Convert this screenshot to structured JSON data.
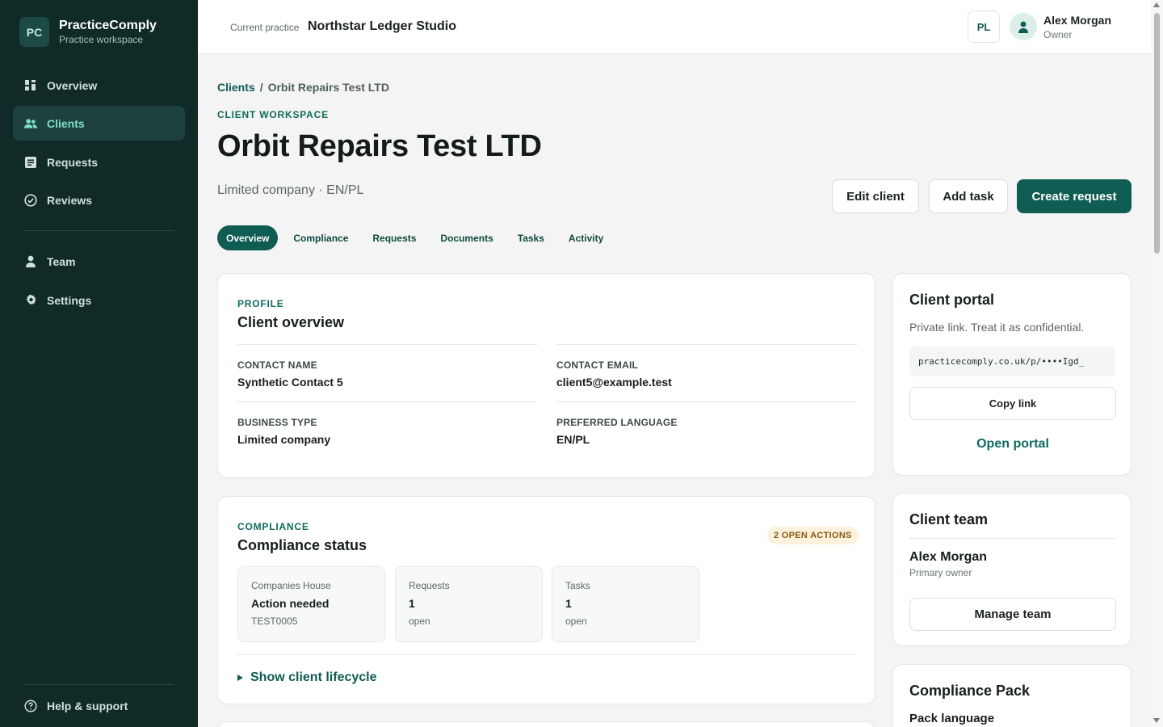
{
  "brand": {
    "logo_text": "PC",
    "name": "PracticeComply",
    "subtitle": "Practice workspace"
  },
  "sidebar": {
    "items": [
      {
        "label": "Overview",
        "icon": "grid-icon"
      },
      {
        "label": "Clients",
        "icon": "users-icon",
        "active": true
      },
      {
        "label": "Requests",
        "icon": "inbox-icon"
      },
      {
        "label": "Reviews",
        "icon": "check-circle-icon"
      },
      {
        "label": "Team",
        "icon": "user-icon"
      },
      {
        "label": "Settings",
        "icon": "gear-icon"
      }
    ],
    "help_label": "Help & support"
  },
  "topbar": {
    "current_practice_label": "Current practice",
    "current_practice_name": "Northstar Ledger Studio",
    "language_badge": "PL",
    "user_name": "Alex Morgan",
    "user_role": "Owner"
  },
  "breadcrumb": {
    "parent": "Clients",
    "separator": "/",
    "current": "Orbit Repairs Test LTD"
  },
  "header": {
    "eyebrow": "CLIENT WORKSPACE",
    "title": "Orbit Repairs Test LTD",
    "subtitle": "Limited company · EN/PL",
    "edit_label": "Edit client",
    "add_task_label": "Add task",
    "create_request_label": "Create request"
  },
  "tabs": [
    "Overview",
    "Compliance",
    "Requests",
    "Documents",
    "Tasks",
    "Activity"
  ],
  "profile": {
    "eyebrow": "PROFILE",
    "title": "Client overview",
    "contact_name_label": "CONTACT NAME",
    "contact_name": "Synthetic Contact 5",
    "contact_email_label": "CONTACT EMAIL",
    "contact_email": "client5@example.test",
    "business_type_label": "BUSINESS TYPE",
    "business_type": "Limited company",
    "language_label": "PREFERRED LANGUAGE",
    "language": "EN/PL"
  },
  "compliance": {
    "eyebrow": "COMPLIANCE",
    "title": "Compliance status",
    "badge": "2 OPEN ACTIONS",
    "stats": [
      {
        "label": "Companies House",
        "value": "Action needed",
        "sub": "TEST0005"
      },
      {
        "label": "Requests",
        "value": "1",
        "sub": "open"
      },
      {
        "label": "Tasks",
        "value": "1",
        "sub": "open"
      }
    ],
    "lifecycle_label": "Show client lifecycle"
  },
  "portal": {
    "title": "Client portal",
    "description": "Private link. Treat it as confidential.",
    "url": "practicecomply.co.uk/p/••••Igd_",
    "copy_label": "Copy link",
    "open_label": "Open portal"
  },
  "team": {
    "title": "Client team",
    "member_name": "Alex Morgan",
    "member_role": "Primary owner",
    "manage_label": "Manage team"
  },
  "pack": {
    "title": "Compliance Pack",
    "subtitle": "Pack language"
  }
}
